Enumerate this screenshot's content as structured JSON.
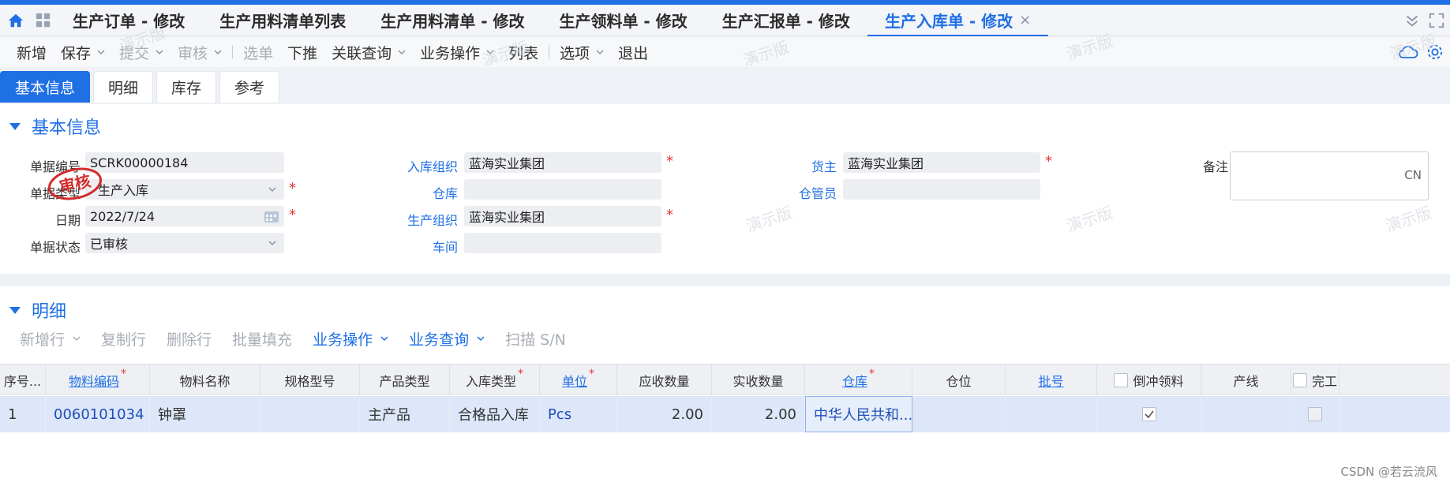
{
  "tabs": [
    {
      "label": "生产订单 - 修改",
      "active": false
    },
    {
      "label": "生产用料清单列表",
      "active": false
    },
    {
      "label": "生产用料清单 - 修改",
      "active": false
    },
    {
      "label": "生产领料单 - 修改",
      "active": false
    },
    {
      "label": "生产汇报单 - 修改",
      "active": false
    },
    {
      "label": "生产入库单 - 修改",
      "active": true
    }
  ],
  "tab_close_glyph": "×",
  "toolbar": {
    "items": [
      {
        "label": "新增",
        "caret": false,
        "disabled": false
      },
      {
        "label": "保存",
        "caret": true,
        "disabled": false
      },
      {
        "label": "提交",
        "caret": true,
        "disabled": true
      },
      {
        "label": "审核",
        "caret": true,
        "disabled": true
      },
      {
        "label": "选单",
        "caret": false,
        "disabled": true
      },
      {
        "label": "下推",
        "caret": false,
        "disabled": false
      },
      {
        "label": "关联查询",
        "caret": true,
        "disabled": false
      },
      {
        "label": "业务操作",
        "caret": true,
        "disabled": false
      },
      {
        "label": "列表",
        "caret": false,
        "disabled": false
      },
      {
        "label": "选项",
        "caret": true,
        "disabled": false
      },
      {
        "label": "退出",
        "caret": false,
        "disabled": false
      }
    ]
  },
  "subtabs": [
    {
      "label": "基本信息",
      "active": true
    },
    {
      "label": "明细",
      "active": false
    },
    {
      "label": "库存",
      "active": false
    },
    {
      "label": "参考",
      "active": false
    }
  ],
  "basic": {
    "title": "基本信息",
    "stamp_text": "审核",
    "fields": {
      "bill_no": {
        "label": "单据编号",
        "value": "SCRK00000184"
      },
      "bill_type": {
        "label": "单据类型",
        "value": "生产入库"
      },
      "date": {
        "label": "日期",
        "value": "2022/7/24"
      },
      "status": {
        "label": "单据状态",
        "value": "已审核"
      },
      "stock_org": {
        "label": "入库组织",
        "value": "蓝海实业集团"
      },
      "warehouse": {
        "label": "仓库",
        "value": ""
      },
      "prd_org": {
        "label": "生产组织",
        "value": "蓝海实业集团"
      },
      "workshop": {
        "label": "车间",
        "value": ""
      },
      "owner": {
        "label": "货主",
        "value": "蓝海实业集团"
      },
      "keeper": {
        "label": "仓管员",
        "value": ""
      },
      "remark": {
        "label": "备注",
        "value": "",
        "lang": "CN"
      }
    },
    "required_mark": "*"
  },
  "detail": {
    "title": "明细",
    "toolbar": [
      {
        "label": "新增行",
        "caret": true,
        "active": false
      },
      {
        "label": "复制行",
        "caret": false,
        "active": false
      },
      {
        "label": "删除行",
        "caret": false,
        "active": false
      },
      {
        "label": "批量填充",
        "caret": false,
        "active": false
      },
      {
        "label": "业务操作",
        "caret": true,
        "active": true
      },
      {
        "label": "业务查询",
        "caret": true,
        "active": true
      },
      {
        "label": "扫描 S/N",
        "caret": false,
        "active": false
      }
    ],
    "columns": [
      {
        "label": "序号...",
        "link": false,
        "required": false
      },
      {
        "label": "物料编码",
        "link": true,
        "required": true
      },
      {
        "label": "物料名称",
        "link": false,
        "required": false
      },
      {
        "label": "规格型号",
        "link": false,
        "required": false
      },
      {
        "label": "产品类型",
        "link": false,
        "required": false
      },
      {
        "label": "入库类型",
        "link": false,
        "required": true
      },
      {
        "label": "单位",
        "link": true,
        "required": true
      },
      {
        "label": "应收数量",
        "link": false,
        "required": false
      },
      {
        "label": "实收数量",
        "link": false,
        "required": false
      },
      {
        "label": "仓库",
        "link": true,
        "required": true
      },
      {
        "label": "仓位",
        "link": false,
        "required": false
      },
      {
        "label": "批号",
        "link": true,
        "required": false
      },
      {
        "label": "倒冲领料",
        "link": false,
        "required": false,
        "checkbox": true
      },
      {
        "label": "产线",
        "link": false,
        "required": false
      },
      {
        "label": "完工",
        "link": false,
        "required": false,
        "checkbox": true
      }
    ],
    "rows": [
      {
        "seq": "1",
        "material_code": "0060101034",
        "material_name": "钟罩",
        "spec": "",
        "product_type": "主产品",
        "in_type": "合格品入库",
        "unit": "Pcs",
        "must_qty": "2.00",
        "real_qty": "2.00",
        "warehouse": "中华人民共和...",
        "location": "",
        "lot": "",
        "backflush": true,
        "line": "",
        "finished": false
      }
    ]
  },
  "watermark_text": "演示版",
  "credit": "CSDN @若云流风",
  "colors": {
    "accent": "#1f6fe5",
    "required": "#e53935",
    "row_selected": "#dde7f9"
  }
}
